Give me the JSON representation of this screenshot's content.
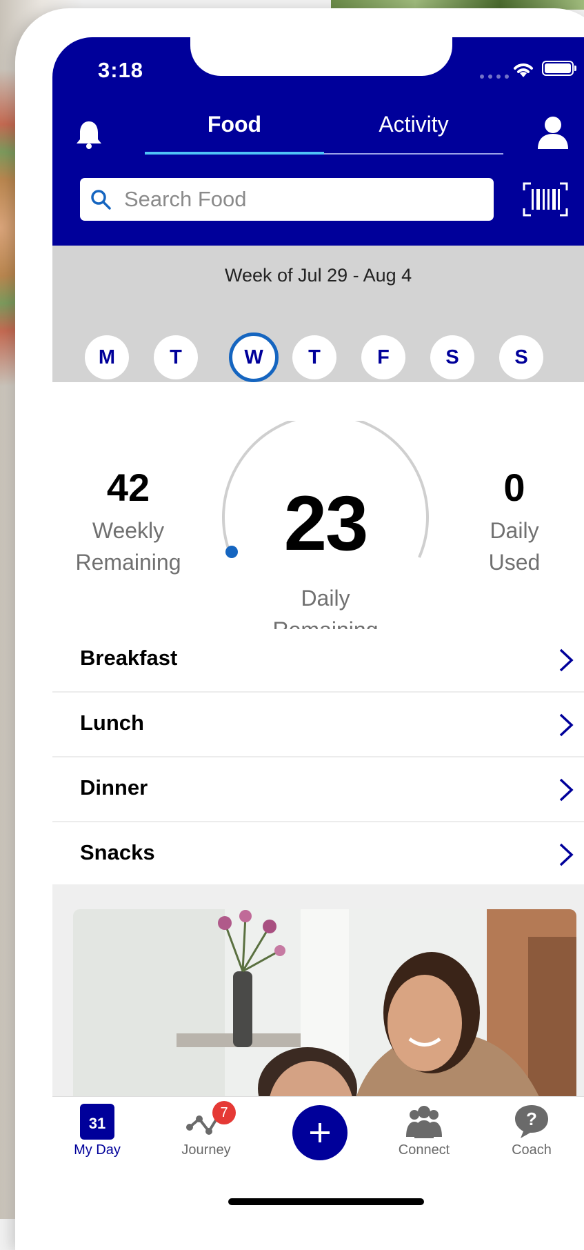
{
  "status_bar": {
    "time": "3:18"
  },
  "header": {
    "tabs": [
      {
        "label": "Food",
        "active": true
      },
      {
        "label": "Activity",
        "active": false
      }
    ],
    "search": {
      "placeholder": "Search Food",
      "value": ""
    },
    "icons": [
      "bell-icon",
      "profile-icon",
      "barcode-scan-icon",
      "search-icon"
    ]
  },
  "week": {
    "label": "Week of Jul 29 - Aug 4",
    "days": [
      "M",
      "T",
      "W",
      "T",
      "F",
      "S",
      "S"
    ],
    "selected_index": 2
  },
  "points": {
    "weekly_remaining": {
      "value": "42",
      "label_line1": "Weekly",
      "label_line2": "Remaining"
    },
    "daily_remaining": {
      "value": "23",
      "label_line1": "Daily",
      "label_line2": "Remaining"
    },
    "daily_used": {
      "value": "0",
      "label_line1": "Daily",
      "label_line2": "Used"
    }
  },
  "meals": [
    {
      "label": "Breakfast"
    },
    {
      "label": "Lunch"
    },
    {
      "label": "Dinner"
    },
    {
      "label": "Snacks"
    }
  ],
  "bottom_nav": {
    "my_day": {
      "label": "My Day",
      "calendar_day": "31"
    },
    "journey": {
      "label": "Journey",
      "badge": "7"
    },
    "connect": {
      "label": "Connect"
    },
    "coach": {
      "label": "Coach"
    }
  },
  "colors": {
    "brand_blue": "#00009a",
    "accent_light_blue": "#4fc3f7",
    "badge_red": "#e53935",
    "band_gray": "#d3d3d3"
  }
}
